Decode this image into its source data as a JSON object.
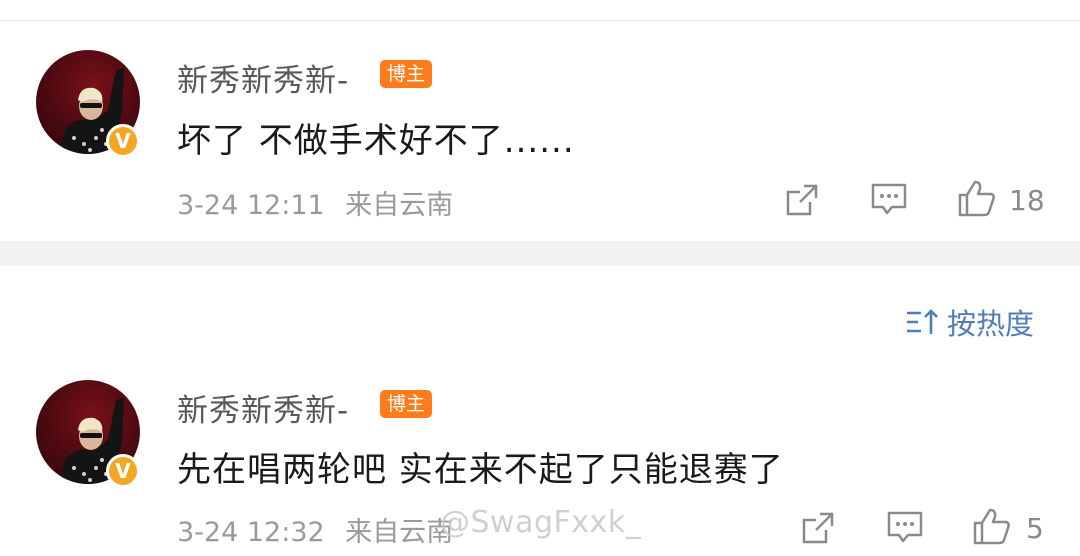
{
  "comments": [
    {
      "username": "新秀新秀新-",
      "tag": "博主",
      "verified_mark": "V",
      "text": "坏了 不做手术好不了......",
      "time": "3-24 12:11",
      "location": "来自云南",
      "likes": "18",
      "icons": [
        "share-icon",
        "comment-icon",
        "like-icon"
      ]
    },
    {
      "username": "新秀新秀新-",
      "tag": "博主",
      "verified_mark": "V",
      "text": "先在唱两轮吧 实在来不起了只能退赛了",
      "time": "3-24 12:32",
      "location": "来自云南",
      "likes": "5",
      "icons": [
        "share-icon",
        "comment-icon",
        "like-icon"
      ]
    }
  ],
  "sort": {
    "label": "按热度",
    "icon": "sort-icon"
  },
  "watermark": "@SwagFxxk_",
  "colors": {
    "tag_bg": "#ff7b1c",
    "verified": "#f5a623",
    "link_blue": "#4f7db5",
    "meta_gray": "#9a9a9a"
  }
}
